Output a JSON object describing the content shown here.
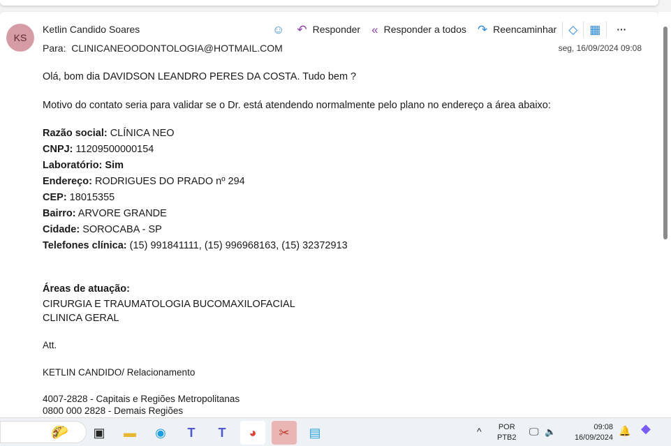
{
  "email": {
    "avatar_initials": "KS",
    "sender": "Ketlin Candido Soares",
    "to_label": "Para:",
    "to": "CLINICANEOODONTOLOGIA@HOTMAIL.COM",
    "date": "seg, 16/09/2024 09:08",
    "actions": {
      "reply": "Responder",
      "reply_all": "Responder a todos",
      "forward": "Reencaminhar",
      "more": "···"
    },
    "body": {
      "greeting": "Olá, bom dia DAVIDSON LEANDRO PERES DA COSTA. Tudo bem ?",
      "intro": "Motivo do contato seria para validar se o Dr. está atendendo normalmente pelo plano no endereço a área abaixo:",
      "fields": [
        {
          "label": "Razão social:",
          "value": " CLÍNICA NEO"
        },
        {
          "label": "CNPJ:",
          "value": " 11209500000154"
        },
        {
          "label": "Laboratório:",
          "value": " Sim"
        },
        {
          "label": "Endereço:",
          "value": " RODRIGUES DO PRADO nº 294"
        },
        {
          "label": "CEP:",
          "value": " 18015355"
        },
        {
          "label": "Bairro:",
          "value": " ARVORE GRANDE"
        },
        {
          "label": "Cidade:",
          "value": " SOROCABA - SP"
        },
        {
          "label": "Telefones clínica:",
          "value": " (15) 991841111, (15) 996968163, (15) 32372913"
        }
      ],
      "areas_title": "Áreas de atuação:",
      "areas": [
        "CIRURGIA E TRAUMATOLOGIA BUCOMAXILOFACIAL",
        "CLINICA GERAL"
      ],
      "closing": "Att.",
      "signature": "KETLIN CANDIDO/ Relacionamento",
      "phones": [
        "4007-2828 - Capitais e Regiões Metropolitanas",
        "0800 000 2828 - Demais Regiões"
      ]
    }
  },
  "taskbar": {
    "lang1": "POR",
    "lang2": "PTB2",
    "time": "09:08",
    "date": "16/09/2024"
  }
}
